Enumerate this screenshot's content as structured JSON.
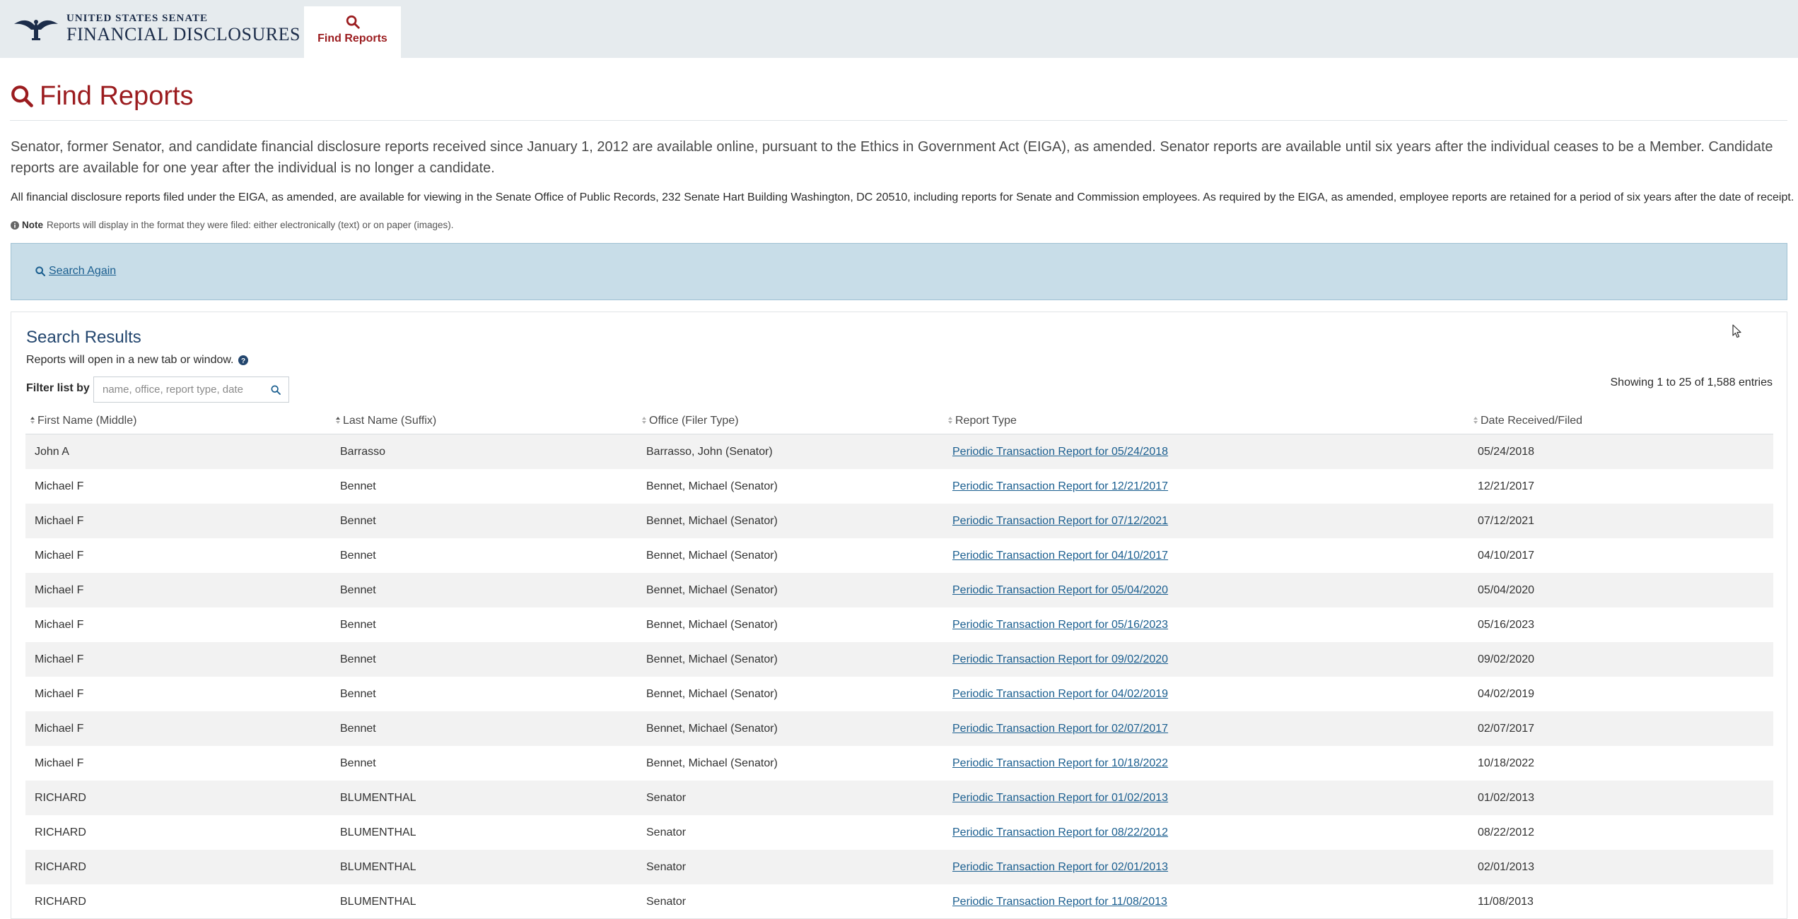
{
  "header": {
    "brand_top": "UNITED STATES SENATE",
    "brand_bottom": "FINANCIAL DISCLOSURES",
    "nav_tab_label": "Find Reports",
    "nav_tab_icon": "search-icon",
    "bg_color": "#e6ebee",
    "accent_color": "#9b1c1f"
  },
  "page": {
    "title": "Find Reports",
    "intro_1": "Senator, former Senator, and candidate financial disclosure reports received since January 1, 2012 are available online, pursuant to the Ethics in Government Act (EIGA), as amended. Senator reports are available until six years after the individual ceases to be a Member. Candidate reports are available for one year after the individual is no longer a candidate.",
    "intro_2": "All financial disclosure reports filed under the EIGA, as amended, are available for viewing in the Senate Office of Public Records, 232 Senate Hart Building Washington, DC 20510, including reports for Senate and Commission employees. As required by the EIGA, as amended, employee reports are retained for a period of six years after the date of receipt.",
    "note_label": "Note",
    "note_text": "Reports will display in the format they were filed: either electronically (text) or on paper (images)."
  },
  "search": {
    "search_again_label": "Search Again"
  },
  "results": {
    "title": "Search Results",
    "subtitle": "Reports will open in a new tab or window.",
    "filter_label": "Filter list by",
    "filter_placeholder": "name, office, report type, date",
    "filter_value": "",
    "entries_info": "Showing 1 to 25 of 1,588 entries",
    "columns": [
      "First Name (Middle)",
      "Last Name (Suffix)",
      "Office (Filer Type)",
      "Report Type",
      "Date Received/Filed"
    ],
    "rows": [
      [
        "John A",
        "Barrasso",
        "Barrasso, John (Senator)",
        "Periodic Transaction Report for 05/24/2018",
        "05/24/2018"
      ],
      [
        "Michael F",
        "Bennet",
        "Bennet, Michael (Senator)",
        "Periodic Transaction Report for 12/21/2017",
        "12/21/2017"
      ],
      [
        "Michael F",
        "Bennet",
        "Bennet, Michael (Senator)",
        "Periodic Transaction Report for 07/12/2021",
        "07/12/2021"
      ],
      [
        "Michael F",
        "Bennet",
        "Bennet, Michael (Senator)",
        "Periodic Transaction Report for 04/10/2017",
        "04/10/2017"
      ],
      [
        "Michael F",
        "Bennet",
        "Bennet, Michael (Senator)",
        "Periodic Transaction Report for 05/04/2020",
        "05/04/2020"
      ],
      [
        "Michael F",
        "Bennet",
        "Bennet, Michael (Senator)",
        "Periodic Transaction Report for 05/16/2023",
        "05/16/2023"
      ],
      [
        "Michael F",
        "Bennet",
        "Bennet, Michael (Senator)",
        "Periodic Transaction Report for 09/02/2020",
        "09/02/2020"
      ],
      [
        "Michael F",
        "Bennet",
        "Bennet, Michael (Senator)",
        "Periodic Transaction Report for 04/02/2019",
        "04/02/2019"
      ],
      [
        "Michael F",
        "Bennet",
        "Bennet, Michael (Senator)",
        "Periodic Transaction Report for 02/07/2017",
        "02/07/2017"
      ],
      [
        "Michael F",
        "Bennet",
        "Bennet, Michael (Senator)",
        "Periodic Transaction Report for 10/18/2022",
        "10/18/2022"
      ],
      [
        "RICHARD",
        "BLUMENTHAL",
        "Senator",
        "Periodic Transaction Report for 01/02/2013",
        "01/02/2013"
      ],
      [
        "RICHARD",
        "BLUMENTHAL",
        "Senator",
        "Periodic Transaction Report for 08/22/2012",
        "08/22/2012"
      ],
      [
        "RICHARD",
        "BLUMENTHAL",
        "Senator",
        "Periodic Transaction Report for 02/01/2013",
        "02/01/2013"
      ],
      [
        "RICHARD",
        "BLUMENTHAL",
        "Senator",
        "Periodic Transaction Report for 11/08/2013",
        "11/08/2013"
      ]
    ]
  }
}
